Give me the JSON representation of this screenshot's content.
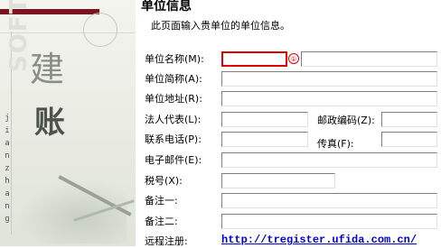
{
  "page": {
    "title": "单位信息",
    "subtitle": "此页面输入贵单位的单位信息。"
  },
  "side": {
    "char1": "建",
    "char2": "账",
    "vertical_text": "jianzhang",
    "watermark": "SOFTWARE"
  },
  "form": {
    "unit_name_label": "单位名称(M):",
    "unit_name_value": "",
    "unit_abbr_label": "单位简称(A):",
    "unit_abbr_value": "",
    "unit_address_label": "单位地址(R):",
    "unit_address_value": "",
    "legal_rep_label": "法人代表(L):",
    "legal_rep_value": "",
    "postcode_label": "邮政编码(Z):",
    "postcode_value": "",
    "phone_label": "联系电话(P):",
    "phone_value": "",
    "fax_label": "传真(F):",
    "fax_value": "",
    "email_label": "电子邮件(E):",
    "email_value": "",
    "tax_label": "税号(X):",
    "tax_value": "",
    "note1_label": "备注一:",
    "note1_value": "",
    "note2_label": "备注二:",
    "note2_value": "",
    "remote_reg_label": "远程注册:",
    "remote_reg_link": "http://tregister.ufida.com.cn/"
  },
  "badge": "①",
  "colors": {
    "accent_bar": "#7a1420",
    "focus_border": "#e00000",
    "link": "#0000cc"
  }
}
